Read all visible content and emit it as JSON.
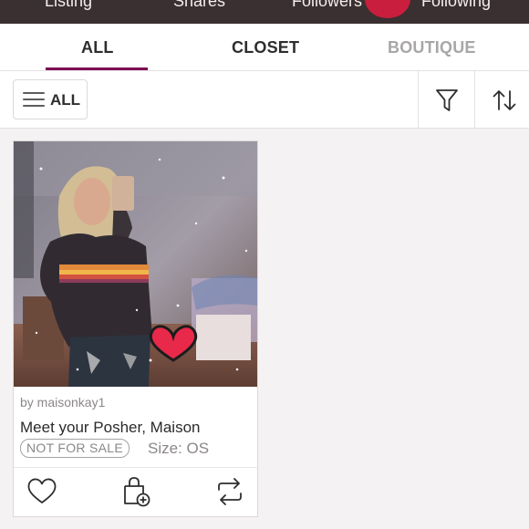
{
  "profile_stats": {
    "labels": [
      "Listing",
      "Shares",
      "Followers",
      "Following"
    ]
  },
  "tabs": [
    {
      "label": "ALL",
      "active": true
    },
    {
      "label": "CLOSET",
      "active": false
    },
    {
      "label": "BOUTIQUE",
      "active": false
    }
  ],
  "filter_bar": {
    "all_label": "ALL",
    "filter_icon": "funnel-icon",
    "sort_icon": "sort-arrows-icon"
  },
  "listing": {
    "by": "by maisonkay1",
    "title": "Meet your Posher, Maison",
    "badge": "NOT FOR SALE",
    "size": "Size: OS",
    "actions": [
      "heart-icon",
      "add-to-bundle-icon",
      "share-icon"
    ]
  },
  "colors": {
    "accent": "#7f0353",
    "heart_red": "#e8294a",
    "stats_bg": "#3a2f31"
  }
}
